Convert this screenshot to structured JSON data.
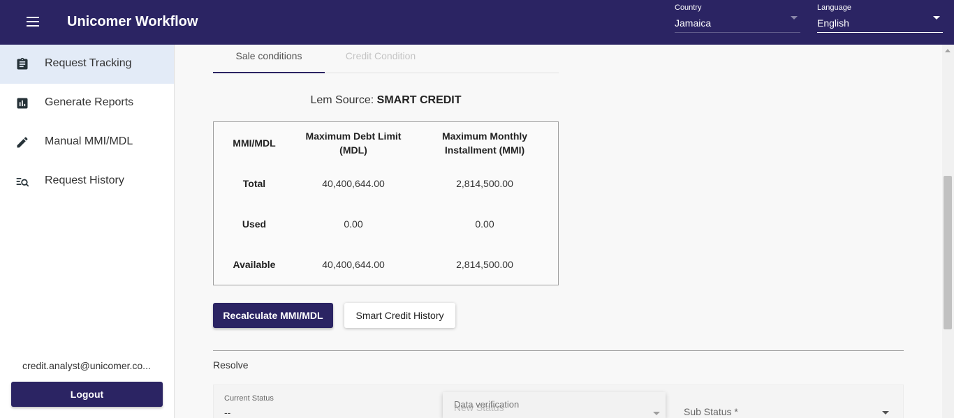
{
  "header": {
    "title": "Unicomer Workflow",
    "country": {
      "label": "Country",
      "value": "Jamaica"
    },
    "language": {
      "label": "Language",
      "value": "English"
    }
  },
  "sidebar": {
    "items": [
      {
        "label": "Request Tracking",
        "icon": "clipboard-icon",
        "active": true
      },
      {
        "label": "Generate Reports",
        "icon": "bar-chart-icon"
      },
      {
        "label": "Manual MMI/MDL",
        "icon": "pencil-icon"
      },
      {
        "label": "Request History",
        "icon": "search-list-icon"
      }
    ],
    "user_email": "credit.analyst@unicomer.co...",
    "logout_label": "Logout"
  },
  "tabs": [
    {
      "label": "Sale conditions",
      "active": true
    },
    {
      "label": "Credit Condition",
      "disabled": true
    }
  ],
  "lem": {
    "prefix": "Lem Source:",
    "value": "SMART CREDIT"
  },
  "mmi_table": {
    "headers": [
      "MMI/MDL",
      "Maximum Debt Limit (MDL)",
      "Maximum Monthly Installment (MMI)"
    ],
    "rows": [
      {
        "label": "Total",
        "mdl": "40,400,644.00",
        "mmi": "2,814,500.00"
      },
      {
        "label": "Used",
        "mdl": "0.00",
        "mmi": "0.00"
      },
      {
        "label": "Available",
        "mdl": "40,400,644.00",
        "mmi": "2,814,500.00"
      }
    ]
  },
  "actions": {
    "recalculate_label": "Recalculate MMI/MDL",
    "history_label": "Smart Credit History"
  },
  "resolve": {
    "title": "Resolve",
    "current_status_label": "Current Status",
    "current_status_value": "--",
    "new_status_placeholder": "New Status",
    "dropdown_option": "Data verification",
    "sub_status_label": "Sub Status *"
  },
  "colors": {
    "brand": "#2b2463",
    "active_nav": "#e3ebf7"
  }
}
